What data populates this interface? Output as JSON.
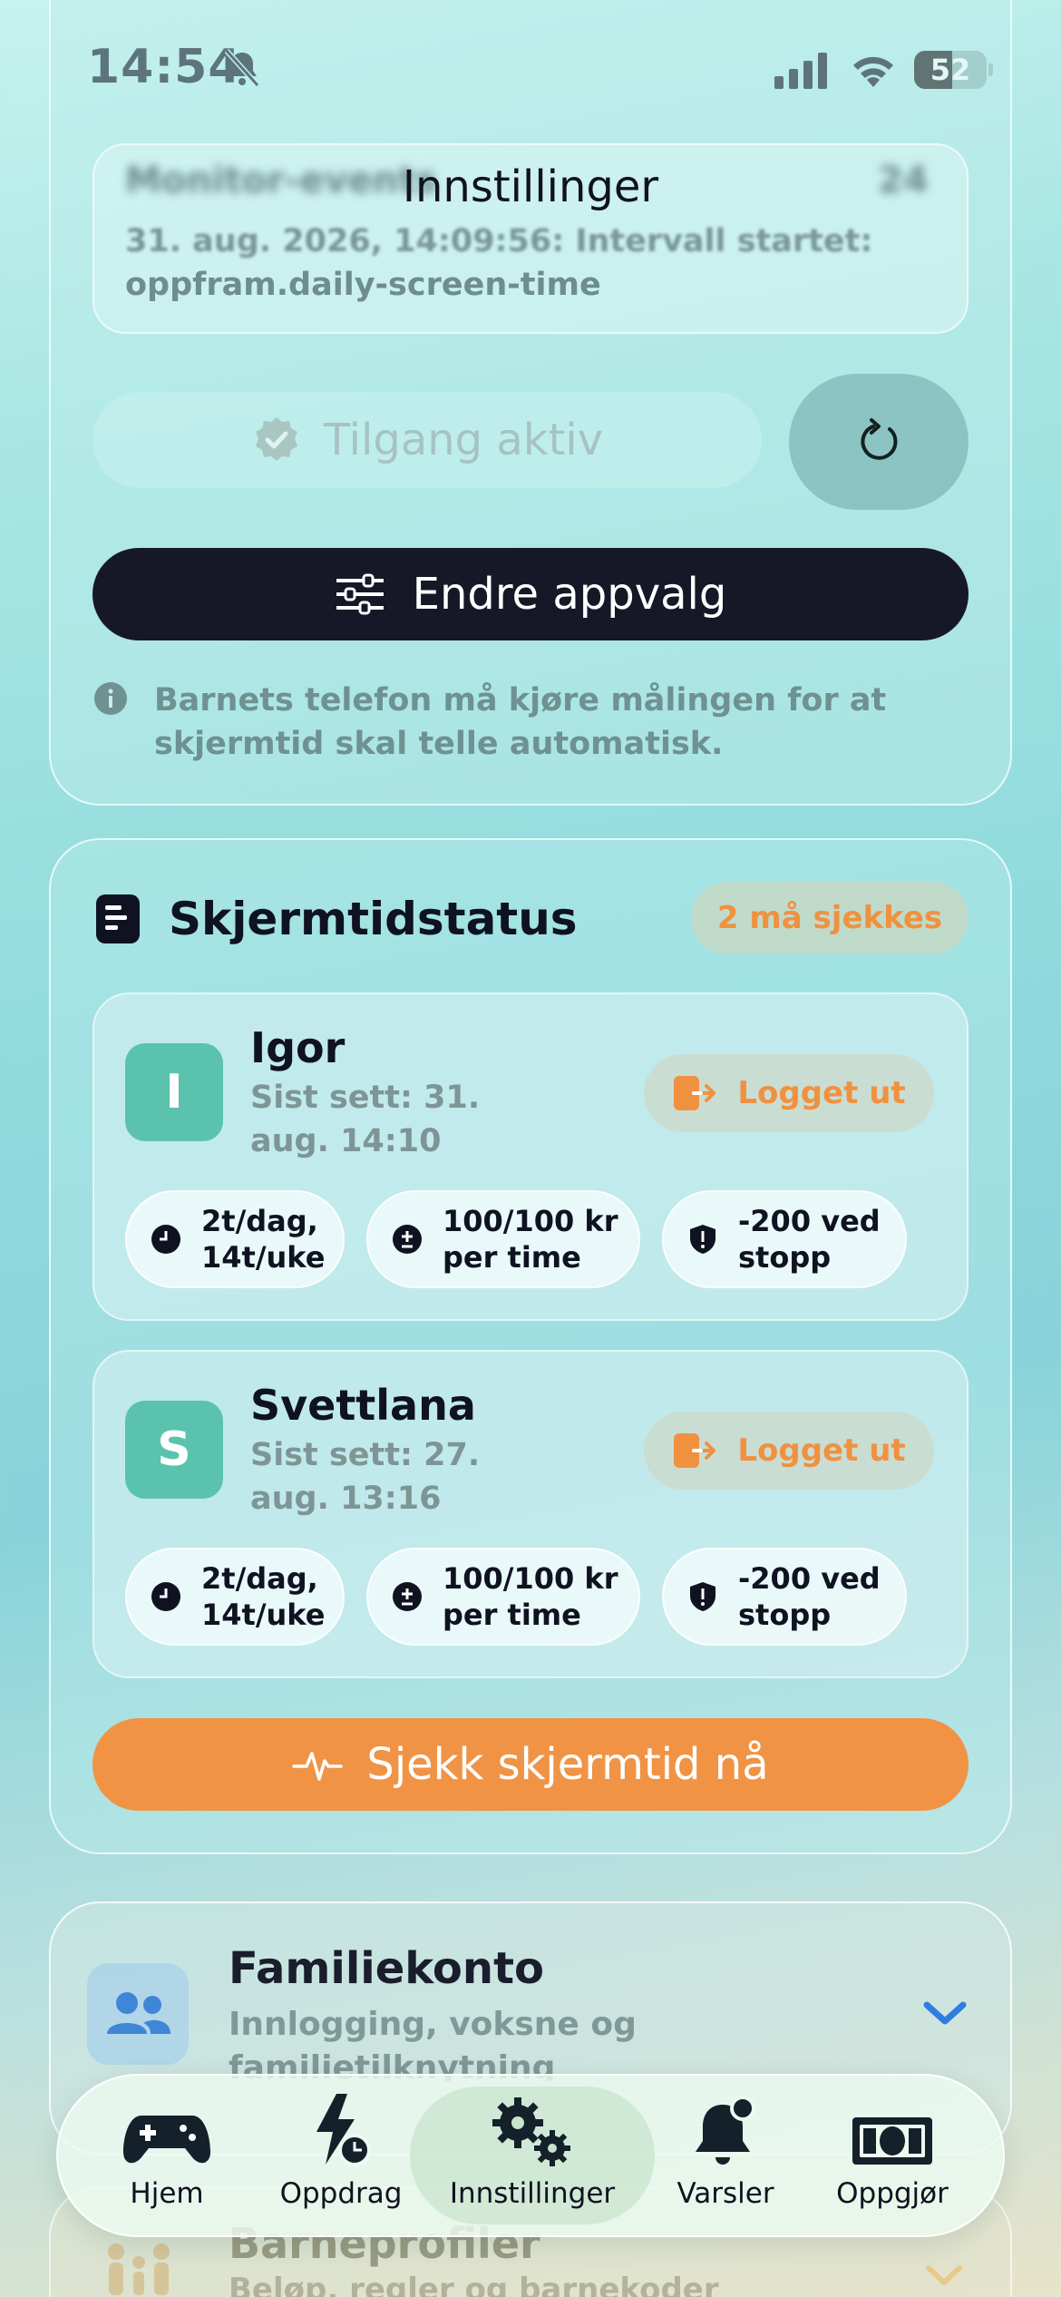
{
  "status_bar": {
    "time": "14:54",
    "battery": "52",
    "battery_level": 0.52
  },
  "header": {
    "title": "Innstillinger"
  },
  "monitor": {
    "title": "Monitor-events",
    "count": "24",
    "line1": "31. aug. 2026, 14:09:56: Intervall startet:",
    "line2": "oppfram.daily-screen-time"
  },
  "access": {
    "label": "Tilgang aktiv"
  },
  "edit_apps": {
    "label": "Endre appvalg"
  },
  "info": {
    "text": "Barnets telefon må kjøre målingen for at skjermtid skal telle automatisk."
  },
  "screen_time": {
    "title": "Skjermtidstatus",
    "badge": "2 må sjekkes",
    "children": [
      {
        "initial": "I",
        "name": "Igor",
        "seen": "Sist sett: 31. aug. 14:10",
        "status": "Logget ut",
        "chips": [
          "2t/dag, 14t/uke",
          "100/100 kr per time",
          "-200 ved stopp"
        ]
      },
      {
        "initial": "S",
        "name": "Svettlana",
        "seen": "Sist sett: 27. aug. 13:16",
        "status": "Logget ut",
        "chips": [
          "2t/dag, 14t/uke",
          "100/100 kr per time",
          "-200 ved stopp"
        ]
      }
    ],
    "check_button": "Sjekk skjermtid nå"
  },
  "family": {
    "title": "Familiekonto",
    "subtitle": "Innlogging, voksne og familietilknytning"
  },
  "child_profiles": {
    "title": "Barneprofiler",
    "subtitle": "Beløp, regler og barnekoder"
  },
  "tabs": [
    {
      "label": "Hjem",
      "icon": "gamepad-icon"
    },
    {
      "label": "Oppdrag",
      "icon": "bolt-clock-icon"
    },
    {
      "label": "Innstillinger",
      "icon": "gears-icon",
      "active": true
    },
    {
      "label": "Varsler",
      "icon": "bell-badge-icon"
    },
    {
      "label": "Oppgjør",
      "icon": "banknote-icon"
    }
  ],
  "colors": {
    "accent_orange": "#f09345",
    "dark_button": "#161827",
    "avatar_green": "#5bc3ad",
    "chevron_blue": "#2f7de1"
  }
}
